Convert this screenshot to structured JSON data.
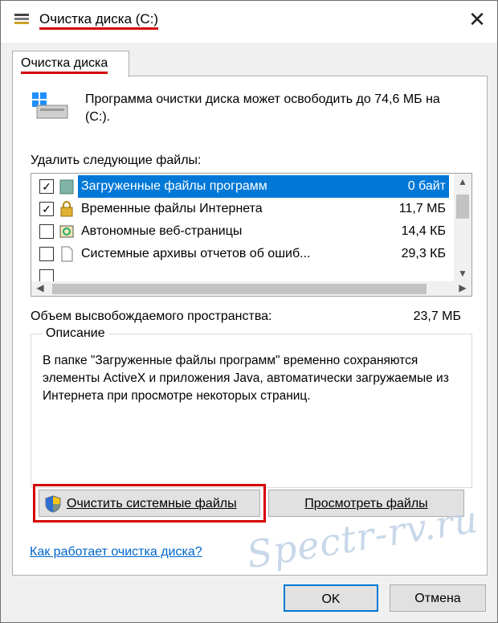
{
  "window": {
    "title": "Очистка диска  (C:)",
    "close_glyph": "✕"
  },
  "tab": {
    "label": "Очистка диска"
  },
  "intro": {
    "text": "Программа очистки диска может освободить до 74,6 МБ на  (C:)."
  },
  "files_section": {
    "label": "Удалить следующие файлы:"
  },
  "file_items": [
    {
      "name": "Загруженные файлы программ",
      "size": "0 байт",
      "checked": true,
      "selected": true,
      "icon": "folder-icon"
    },
    {
      "name": "Временные файлы Интернета",
      "size": "11,7 МБ",
      "checked": true,
      "selected": false,
      "icon": "lock-icon"
    },
    {
      "name": "Автономные веб-страницы",
      "size": "14,4 КБ",
      "checked": false,
      "selected": false,
      "icon": "sync-icon"
    },
    {
      "name": "Системные архивы отчетов об ошиб...",
      "size": "29,3 КБ",
      "checked": false,
      "selected": false,
      "icon": "document-icon"
    }
  ],
  "space": {
    "label": "Объем высвобождаемого пространства:",
    "value": "23,7 МБ"
  },
  "description": {
    "title": "Описание",
    "text": "В папке \"Загруженные файлы программ\" временно сохраняются элементы ActiveX и приложения Java, автоматически загружаемые из Интернета при просмотре некоторых страниц."
  },
  "buttons": {
    "cleanup_system": "Очистить системные файлы",
    "view_files": "Просмотреть файлы",
    "ok": "OK",
    "cancel": "Отмена"
  },
  "help_link": "Как работает очистка диска?",
  "watermark": "Spectr-rv.ru",
  "colors": {
    "selection": "#0078d7",
    "highlight": "#d40000",
    "link": "#0066cc"
  }
}
